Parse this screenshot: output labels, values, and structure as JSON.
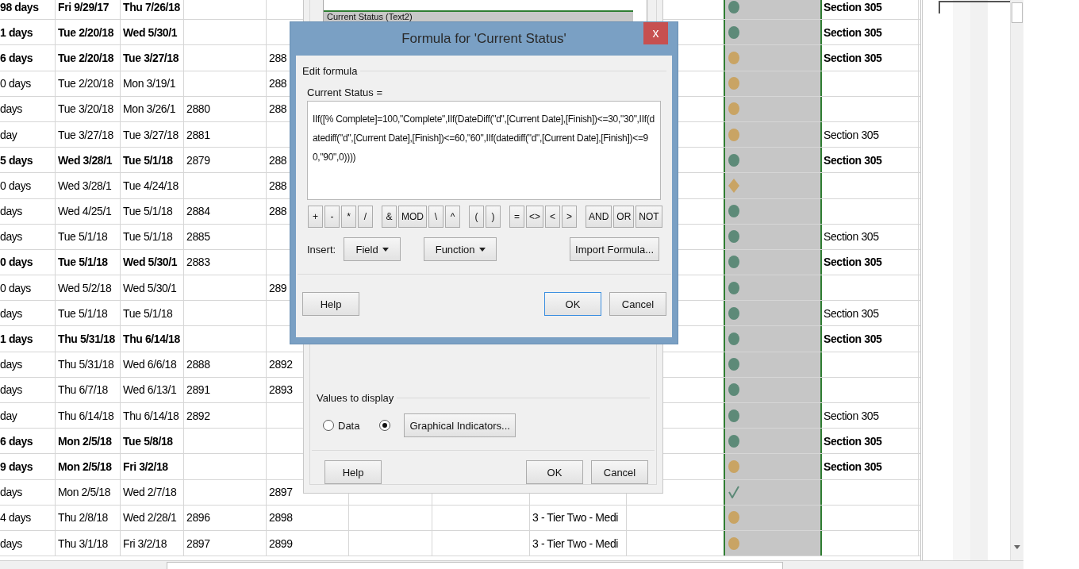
{
  "table": {
    "rows": [
      {
        "duration": "98 days",
        "start": "Fri 9/29/17",
        "finish": "Thu 7/26/18",
        "indicator": {
          "kind": "circle",
          "color": "#5d8a78"
        },
        "section": "Section 305",
        "bold": true
      },
      {
        "duration": "1 days",
        "start": "Tue 2/20/18",
        "finish": "Wed 5/30/1",
        "indicator": {
          "kind": "circle",
          "color": "#5d8a78"
        },
        "section": "Section 305",
        "bold": true
      },
      {
        "duration": "6 days",
        "start": "Tue 2/20/18",
        "finish": "Tue 3/27/18",
        "successors": "288",
        "indicator": {
          "kind": "circle",
          "color": "#c9a464"
        },
        "section": "Section 305",
        "bold": true
      },
      {
        "duration": "0 days",
        "start": "Tue 2/20/18",
        "finish": "Mon 3/19/1",
        "successors": "288",
        "indicator": {
          "kind": "circle",
          "color": "#c9a464"
        },
        "bold": false
      },
      {
        "duration": "days",
        "start": "Tue 3/20/18",
        "finish": "Mon 3/26/1",
        "predecessors": "2880",
        "successors": "288",
        "indicator": {
          "kind": "circle",
          "color": "#c9a464"
        },
        "bold": false
      },
      {
        "duration": "day",
        "start": "Tue 3/27/18",
        "finish": "Tue 3/27/18",
        "predecessors": "2881",
        "indicator": {
          "kind": "circle",
          "color": "#c9a464"
        },
        "section": "Section 305",
        "bold": false
      },
      {
        "duration": "5 days",
        "start": "Wed 3/28/1",
        "finish": "Tue 5/1/18",
        "predecessors": "2879",
        "successors": "288",
        "indicator": {
          "kind": "circle",
          "color": "#5d8a78"
        },
        "section": "Section 305",
        "bold": true
      },
      {
        "duration": "0 days",
        "start": "Wed 3/28/1",
        "finish": "Tue 4/24/18",
        "successors": "288",
        "indicator": {
          "kind": "diamond",
          "color": "#c9a464"
        },
        "bold": false
      },
      {
        "duration": "days",
        "start": "Wed 4/25/1",
        "finish": "Tue 5/1/18",
        "predecessors": "2884",
        "successors": "288",
        "indicator": {
          "kind": "circle",
          "color": "#5d8a78"
        },
        "bold": false
      },
      {
        "duration": "days",
        "start": "Tue 5/1/18",
        "finish": "Tue 5/1/18",
        "predecessors": "2885",
        "indicator": {
          "kind": "circle",
          "color": "#5d8a78"
        },
        "section": "Section 305",
        "bold": false
      },
      {
        "duration": "0 days",
        "start": "Tue 5/1/18",
        "finish": "Wed 5/30/1",
        "predecessors": "2883",
        "indicator": {
          "kind": "circle",
          "color": "#5d8a78"
        },
        "section": "Section 305",
        "bold": true
      },
      {
        "duration": "0 days",
        "start": "Wed 5/2/18",
        "finish": "Wed 5/30/1",
        "successors": "289",
        "indicator": {
          "kind": "circle",
          "color": "#5d8a78"
        },
        "bold": false
      },
      {
        "duration": "days",
        "start": "Tue 5/1/18",
        "finish": "Tue 5/1/18",
        "indicator": {
          "kind": "circle",
          "color": "#5d8a78"
        },
        "section": "Section 305",
        "bold": false
      },
      {
        "duration": "1 days",
        "start": "Thu 5/31/18",
        "finish": "Thu 6/14/18",
        "indicator": {
          "kind": "circle",
          "color": "#5d8a78"
        },
        "section": "Section 305",
        "bold": true
      },
      {
        "duration": "days",
        "start": "Thu 5/31/18",
        "finish": "Wed 6/6/18",
        "predecessors": "2888",
        "successors": "2892",
        "indicator": {
          "kind": "circle",
          "color": "#5d8a78"
        },
        "bold": false
      },
      {
        "duration": "days",
        "start": "Thu 6/7/18",
        "finish": "Wed 6/13/1",
        "predecessors": "2891",
        "successors": "2893",
        "indicator": {
          "kind": "circle",
          "color": "#5d8a78"
        },
        "bold": false
      },
      {
        "duration": "day",
        "start": "Thu 6/14/18",
        "finish": "Thu 6/14/18",
        "predecessors": "2892",
        "indicator": {
          "kind": "circle",
          "color": "#5d8a78"
        },
        "section": "Section 305",
        "bold": false
      },
      {
        "duration": "6 days",
        "start": "Mon 2/5/18",
        "finish": "Tue 5/8/18",
        "indicator": {
          "kind": "circle",
          "color": "#5d8a78"
        },
        "section": "Section 305",
        "bold": true
      },
      {
        "duration": "9 days",
        "start": "Mon 2/5/18",
        "finish": "Fri 3/2/18",
        "indicator": {
          "kind": "circle",
          "color": "#c9a464"
        },
        "section": "Section 305",
        "bold": true
      },
      {
        "duration": "days",
        "start": "Mon 2/5/18",
        "finish": "Wed 2/7/18",
        "successors": "2897",
        "indicator": {
          "kind": "check",
          "color": "#5d8a78"
        },
        "bold": false
      },
      {
        "duration": "4 days",
        "start": "Thu 2/8/18",
        "finish": "Wed 2/28/1",
        "predecessors": "2896",
        "successors": "2898",
        "priority": "3 - Tier Two - Medi",
        "indicator": {
          "kind": "circle",
          "color": "#c9a464"
        },
        "bold": false
      },
      {
        "duration": "days",
        "start": "Thu 3/1/18",
        "finish": "Fri 3/2/18",
        "predecessors": "2897",
        "successors": "2899",
        "priority": "3 - Tier Two - Medi",
        "indicator": {
          "kind": "circle",
          "color": "#c9a464"
        },
        "bold": false
      }
    ]
  },
  "custom_fields_dialog": {
    "list": [
      {
        "label": "Current Status (Text2)",
        "selected": true
      }
    ],
    "values_to_display": {
      "title": "Values to display",
      "options": [
        {
          "kind": "labeled",
          "label": "Data",
          "selected": false
        },
        {
          "kind": "button",
          "button": "Graphical Indicators...",
          "selected": true
        }
      ]
    },
    "buttons": [
      {
        "label": "Help",
        "default": false
      },
      {
        "label": "OK",
        "default": false
      },
      {
        "label": "Cancel",
        "default": false
      }
    ]
  },
  "formula_dialog": {
    "title": "Formula for 'Current Status'",
    "close": "x",
    "group": "Edit formula",
    "field_label": "Current Status =",
    "formula": "IIf([% Complete]=100,\"Complete\",IIf(DateDiff(\"d\",[Current Date],[Finish])<=30,\"30\",IIf(datediff(\"d\",[Current Date],[Finish])<=60,\"60\",IIf(datediff(\"d\",[Current Date],[Finish])<=90,\"90\",0))))",
    "operators": [
      [
        "+",
        "-",
        "*",
        "/"
      ],
      [
        "&",
        "MOD",
        "\\",
        "^"
      ],
      [
        "(",
        ")"
      ],
      [
        "=",
        "<>",
        "<",
        ">"
      ],
      [
        "AND",
        "OR",
        "NOT"
      ]
    ],
    "insert_label": "Insert:",
    "insert_menus": [
      "Field",
      "Function"
    ],
    "import_button": "Import Formula...",
    "buttons": [
      {
        "label": "Help",
        "default": false
      },
      {
        "label": "OK",
        "default": true
      },
      {
        "label": "Cancel",
        "default": false
      }
    ]
  }
}
